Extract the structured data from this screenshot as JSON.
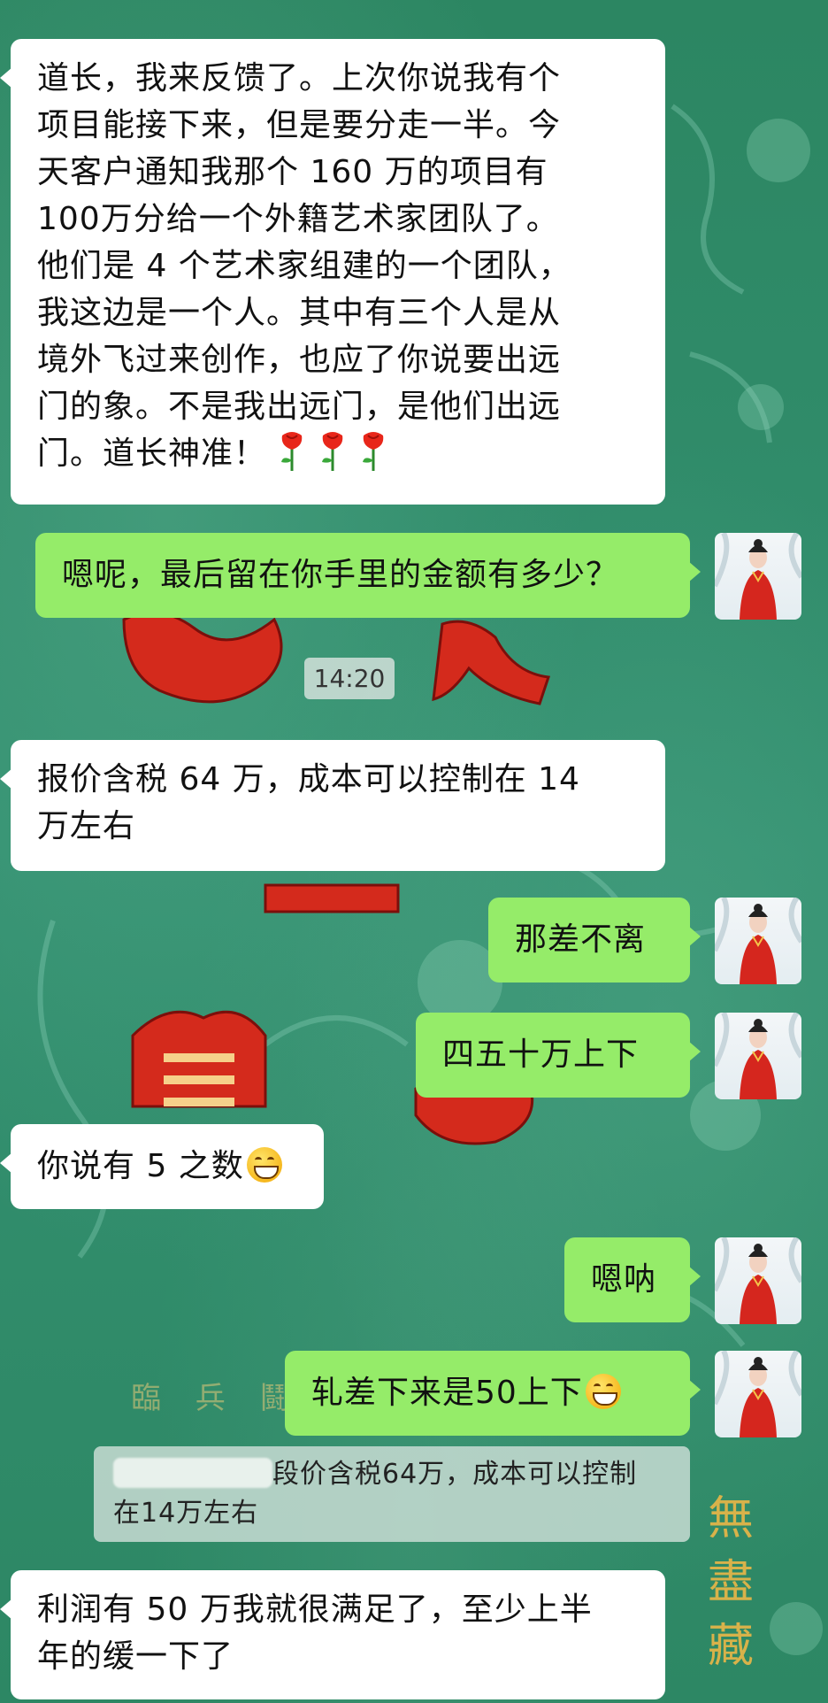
{
  "chat": {
    "timestamp": "14:20",
    "colors": {
      "background": "#2f8a66",
      "incoming_bubble": "#ffffff",
      "outgoing_bubble": "#95ec69"
    },
    "messages": [
      {
        "id": "m1",
        "side": "left",
        "lines": [
          "道长，我来反馈了。上次你说我有个",
          "项目能接下来，但是要分走一半。今",
          "天客户通知我那个 160 万的项目有",
          "100万分给一个外籍艺术家团队了。",
          "他们是 4 个艺术家组建的一个团队，",
          "我这边是一个人。其中有三个人是从",
          "境外飞过来创作，也应了你说要出远",
          "门的象。不是我出远门，是他们出远",
          "门。道长神准！"
        ],
        "emoji": "rose",
        "emoji_count": 3
      },
      {
        "id": "m2",
        "side": "right",
        "lines": [
          "嗯呢，最后留在你手里的金额有多少？"
        ]
      },
      {
        "id": "m3",
        "side": "left",
        "lines": [
          "报价含税 64 万，成本可以控制在 14",
          "万左右"
        ]
      },
      {
        "id": "m4",
        "side": "right",
        "lines": [
          "那差不离"
        ]
      },
      {
        "id": "m5",
        "side": "right",
        "lines": [
          "四五十万上下"
        ]
      },
      {
        "id": "m6",
        "side": "left",
        "lines": [
          "你说有 5 之数"
        ],
        "emoji": "grin"
      },
      {
        "id": "m7",
        "side": "right",
        "lines": [
          "嗯呐"
        ]
      },
      {
        "id": "m8",
        "side": "right",
        "lines": [
          "轧差下来是50上下"
        ],
        "emoji": "grin"
      },
      {
        "id": "m9",
        "side": "left",
        "lines": [
          "利润有 50 万我就很满足了，至少上半",
          "年的缓一下了"
        ]
      }
    ],
    "quote": {
      "line1": "段价含税64万，成本可以控制",
      "line2": "在14万左右"
    }
  },
  "background_art": {
    "left_seal_text": "臨 兵 鬪",
    "right_seal_text": [
      "無",
      "盡",
      "藏"
    ]
  }
}
